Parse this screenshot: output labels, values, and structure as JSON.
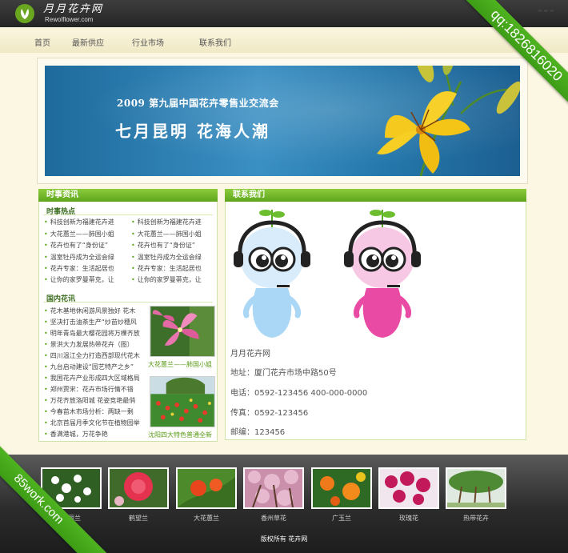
{
  "header": {
    "logo_text": "月月花卉网",
    "logo_sub": "Rewolflower.com"
  },
  "ribbons": {
    "qq": "qq:1826816020",
    "site": "85work.com"
  },
  "nav": {
    "items": [
      "首页",
      "最新供应",
      "行业市场",
      "联系我们"
    ]
  },
  "banner": {
    "subtitle": "2009 第九届中国花卉零售业交流会",
    "title": "七月昆明  花海人潮"
  },
  "left_panel": {
    "title": "时事资讯",
    "hot_title": "时事热点",
    "hot_items_left": [
      "科技创新为福建花卉进",
      "大花蕙兰——肺国小姐",
      "花卉也有了“身份证”",
      "温室牡丹成为全运会绿",
      "花卉专家：生活起居也",
      "让你的家罗曼蒂克，让"
    ],
    "hot_items_right": [
      "科技创新为福建花卉进",
      "大花蕙兰——肺国小姐",
      "花卉也有了“身份证”",
      "温室牡丹成为全运会绿",
      "花卉专家：生活起居也",
      "让你的家罗曼蒂克，让"
    ],
    "domestic_title": "国内花讯",
    "domestic_items": [
      "花木基地休闲游风景独好  花木",
      "坚决打击油茶生产“炒苗炒穗风",
      "明年青岛最大樱花园将万棵齐放",
      "景洪大力发展热带花卉（图）",
      "四川温江全力打造西部现代花木",
      "九台启动建设“园艺特产之乡”",
      "我国花卉产业形成四大区域格局",
      "郑州贾宋：花卉市场行情不错",
      "万花齐放洛阳城  花姿竞艳最俏",
      "今春苗木市场分析：两缺一剩",
      "北京首届月季文化节在植物园举",
      "香满港城，万花争艳"
    ],
    "photo_captions": [
      "大花蕙兰——肺国小姐",
      "沈阳四大特色普通全新"
    ]
  },
  "right_panel": {
    "title": "联系我们",
    "company": "月月花卉网",
    "address": "地址：厦门花卉市场中路50号",
    "phone": "电话：0592-123456 400-000-0000",
    "fax": "传真：0592-123456",
    "postcode": "邮编：123456"
  },
  "gallery": {
    "items": [
      "简丽兰",
      "鹤望兰",
      "大花蕙兰",
      "香州草花",
      "广玉兰",
      "玫瑰花",
      "热带花卉"
    ]
  },
  "footer": {
    "copyright": "版权所有  花卉网"
  },
  "colors": {
    "accent_green": "#5ea51c",
    "header_dark": "#2c2c2c",
    "banner_blue": "#2a7fb5",
    "page_cream": "#fbf7e2"
  }
}
